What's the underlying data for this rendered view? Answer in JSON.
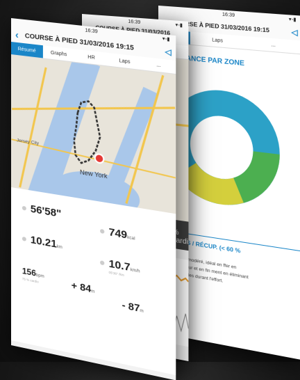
{
  "app": {
    "time": "16:39",
    "title": "COURSE À PIED 31/03/2016 19:15"
  },
  "tabs": [
    "Résumé",
    "Graphs",
    "HR",
    "Laps",
    "..."
  ],
  "map": {
    "labels": [
      "Jersey City",
      "New York"
    ]
  },
  "stats": {
    "duration": "56'58\"",
    "calories": "749",
    "calories_unit": "kcal",
    "distance": "10.21",
    "distance_unit": "km",
    "speed": "10.7",
    "speed_unit": "km/h",
    "speed_sub": "05'36\" /km",
    "hr": "156",
    "hr_unit": "bpm",
    "hr_sub": "75 % cardio",
    "ascent": "+ 84",
    "ascent_unit": "m",
    "descent": "- 87",
    "descent_unit": "m"
  },
  "screen2": {
    "tab_laps": "Laps",
    "cardio_label": "% cardio"
  },
  "screen3": {
    "tab_laps": "Laps",
    "zone_title": "ANCE PAR ZONE",
    "donut_pct": "25 %",
    "recovery_title": "ENTS / RÉCUP. (< 60 %",
    "recovery_text": "effort modéré, idéal en ffer en douceur et en fin ment en éliminant les cides durant l'effort."
  },
  "colors": {
    "accent": "#1a86c8",
    "route_marker": "#e53935"
  }
}
